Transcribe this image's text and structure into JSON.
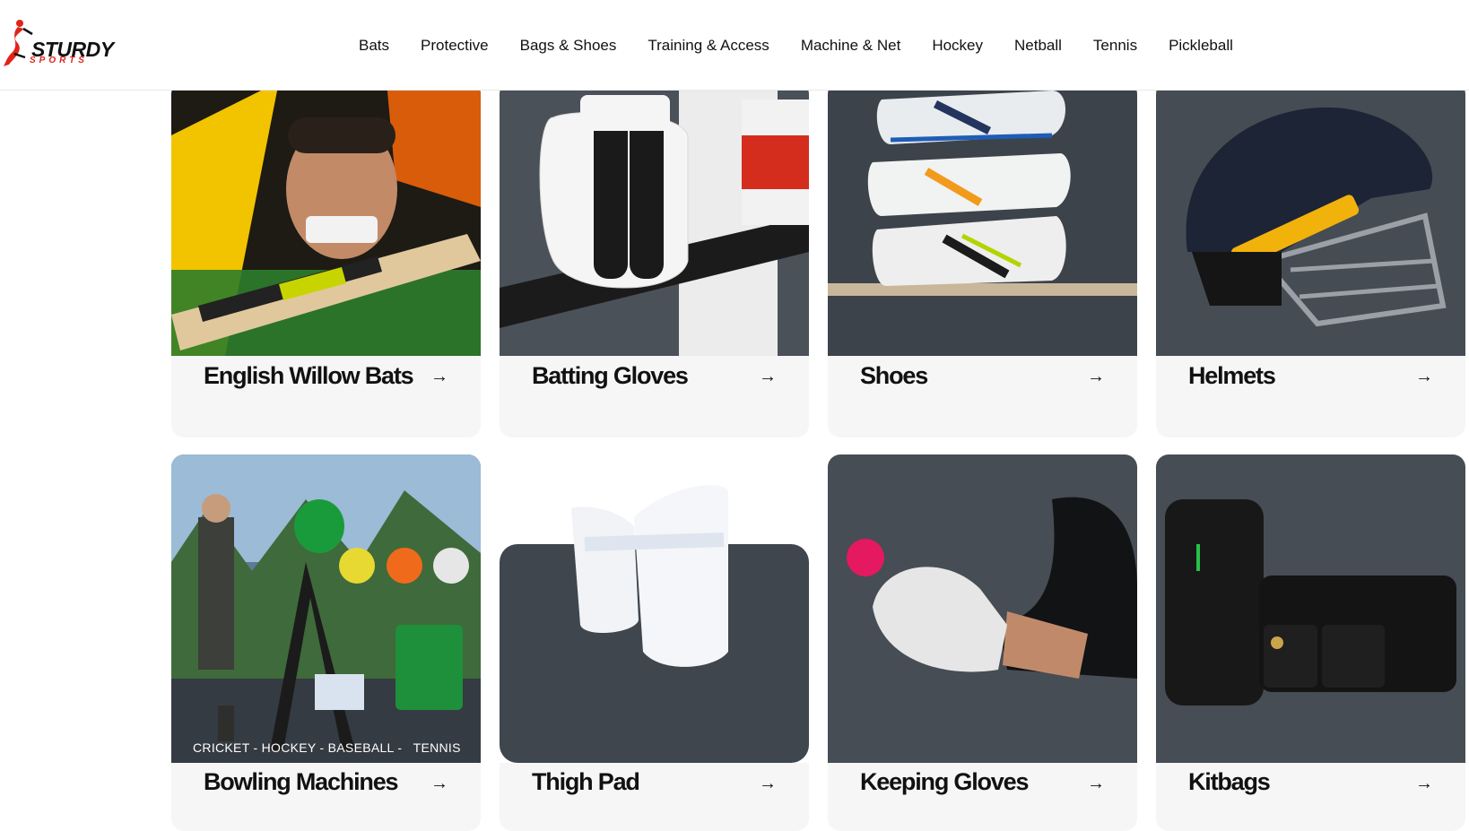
{
  "brand": {
    "name_line1": "STURDY",
    "name_line2": "SPORTS",
    "accent": "#e2231a"
  },
  "nav": {
    "items": [
      "Bats",
      "Protective",
      "Bags & Shoes",
      "Training & Access",
      "Machine & Net",
      "Hockey",
      "Netball",
      "Tennis",
      "Pickleball"
    ]
  },
  "categories": [
    {
      "label": "English Willow Bats",
      "arrow": "→",
      "image": "cricket-player-with-bat"
    },
    {
      "label": "Batting Gloves",
      "arrow": "→",
      "image": "batting-gloves-on-bat"
    },
    {
      "label": "Shoes",
      "arrow": "→",
      "image": "stacked-cricket-shoes"
    },
    {
      "label": "Helmets",
      "arrow": "→",
      "image": "navy-helmet"
    },
    {
      "label": "Bowling Machines",
      "arrow": "→",
      "image": "bowling-machine-with-balls",
      "caption": "CRICKET - HOCKEY - BASEBALL -   TENNIS"
    },
    {
      "label": "Thigh Pad",
      "arrow": "→",
      "image": "white-thigh-pad"
    },
    {
      "label": "Keeping Gloves",
      "arrow": "→",
      "image": "keeping-glove-catching-ball"
    },
    {
      "label": "Kitbags",
      "arrow": "→",
      "image": "black-kitbags"
    }
  ]
}
